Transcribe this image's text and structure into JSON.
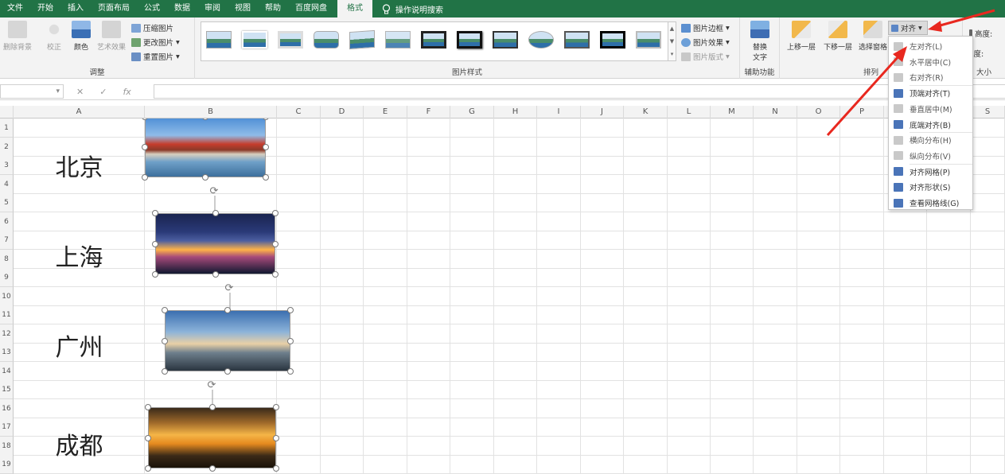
{
  "menu": {
    "tabs": [
      "文件",
      "开始",
      "插入",
      "页面布局",
      "公式",
      "数据",
      "审阅",
      "视图",
      "帮助",
      "百度网盘"
    ],
    "active_tab": "格式",
    "search_label": "操作说明搜索"
  },
  "ribbon": {
    "adjust": {
      "group_label": "调整",
      "remove_bg": "删除背景",
      "correct": "校正",
      "color": "颜色",
      "art_effects": "艺术效果",
      "compress": "压缩图片",
      "change": "更改图片",
      "reset": "重置图片"
    },
    "styles": {
      "group_label": "图片样式",
      "border": "图片边框",
      "effects": "图片效果",
      "layout": "图片版式",
      "thumb_count": 13
    },
    "accessibility": {
      "group_label": "辅助功能",
      "alt_text_l1": "替换",
      "alt_text_l2": "文字"
    },
    "arrange": {
      "group_label": "排列",
      "bring_forward": "上移一层",
      "send_backward": "下移一层",
      "selection_pane": "选择窗格",
      "align": "对齐"
    },
    "size": {
      "group_label": "大小",
      "height": "高度:",
      "width": "宽度:"
    }
  },
  "align_menu": {
    "items": [
      {
        "label": "左对齐(L)",
        "enabled": false
      },
      {
        "label": "水平居中(C)",
        "enabled": false
      },
      {
        "label": "右对齐(R)",
        "enabled": false
      },
      {
        "label": "顶端对齐(T)",
        "enabled": true
      },
      {
        "label": "垂直居中(M)",
        "enabled": false
      },
      {
        "label": "底端对齐(B)",
        "enabled": true
      },
      {
        "label": "横向分布(H)",
        "enabled": false
      },
      {
        "label": "纵向分布(V)",
        "enabled": false
      },
      {
        "label": "对齐网格(P)",
        "enabled": true
      },
      {
        "label": "对齐形状(S)",
        "enabled": true
      },
      {
        "label": "查看网格线(G)",
        "enabled": true
      }
    ]
  },
  "formula_bar": {
    "cancel": "✕",
    "enter": "✓",
    "fx": "fx"
  },
  "columns": [
    "A",
    "B",
    "C",
    "D",
    "E",
    "F",
    "G",
    "H",
    "I",
    "J",
    "K",
    "L",
    "M",
    "N",
    "O",
    "P",
    "Q",
    "R",
    "S"
  ],
  "rows": [
    "1",
    "2",
    "3",
    "4",
    "5",
    "6",
    "7",
    "8",
    "9",
    "10",
    "11",
    "12",
    "13",
    "14",
    "15",
    "16",
    "17",
    "18",
    "19"
  ],
  "cities": [
    "北京",
    "上海",
    "广州",
    "成都"
  ]
}
